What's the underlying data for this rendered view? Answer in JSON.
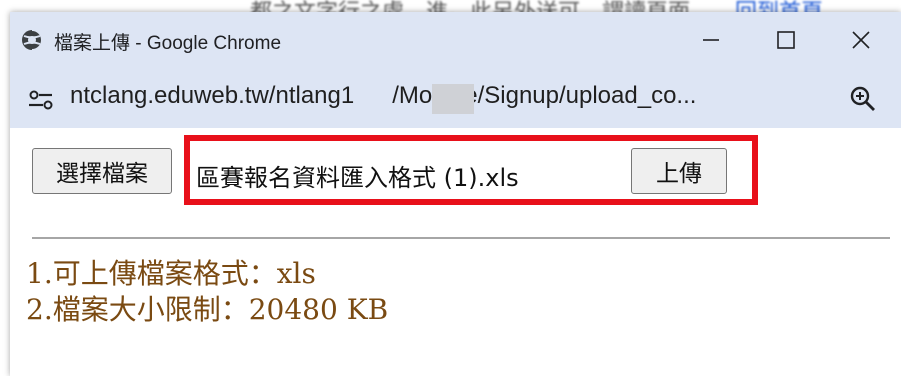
{
  "background_page": {
    "text_fragment": "都之文字行之處，進。此另外送可，謂讀頁面，",
    "link_fragment": "回到首頁"
  },
  "window": {
    "title": "檔案上傳 - Google Chrome",
    "controls": {
      "minimize": "—",
      "maximize": "☐",
      "close": "✕"
    }
  },
  "address_bar": {
    "url_start": "ntclang.eduweb.tw/ntlang1",
    "url_end": "/Module/Signup/upload_co...",
    "site_info_icon": "site-settings-icon",
    "zoom_icon": "zoom-icon"
  },
  "upload_form": {
    "choose_file_label": "選擇檔案",
    "selected_file_name": "區賽報名資料匯入格式 (1).xls",
    "upload_label": "上傳",
    "highlight_color": "#e8101a"
  },
  "notes": [
    "1.可上傳檔案格式：xls",
    "2.檔案大小限制：20480 KB"
  ],
  "colors": {
    "titlebar": "#dde5f4",
    "note_text": "#7a4a12"
  }
}
